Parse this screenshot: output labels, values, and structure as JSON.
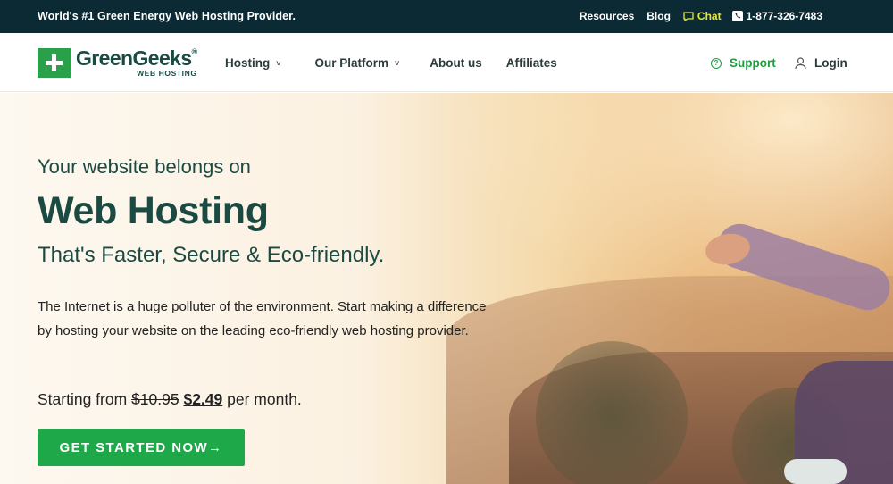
{
  "topbar": {
    "tagline": "World's #1 Green Energy Web Hosting Provider.",
    "resources": "Resources",
    "blog": "Blog",
    "chat": "Chat",
    "phone": "1-877-326-7483"
  },
  "logo": {
    "name": "GreenGeeks",
    "reg": "®",
    "sub": "WEB HOSTING"
  },
  "nav": {
    "items": [
      {
        "label": "Hosting",
        "chevron": "˅"
      },
      {
        "label": "Our Platform",
        "chevron": "˅"
      },
      {
        "label": "About us"
      },
      {
        "label": "Affiliates"
      }
    ],
    "support": "Support",
    "login": "Login"
  },
  "hero": {
    "sub1": "Your website belongs on",
    "title": "Web Hosting",
    "sub2": "That's Faster, Secure & Eco-friendly.",
    "description": "The Internet is a huge polluter of the environment. Start making a difference by hosting your website on the leading eco-friendly web hosting provider.",
    "price_prefix": "Starting from",
    "price_old": "$10.95",
    "price_new": "$2.49",
    "price_suffix": "per month.",
    "cta": "GET STARTED NOW→"
  },
  "colors": {
    "brand_green": "#1ea84a",
    "dark_green": "#1b4a43",
    "topbar_bg": "#0c2a33",
    "chat_yellow": "#e6e93a"
  }
}
